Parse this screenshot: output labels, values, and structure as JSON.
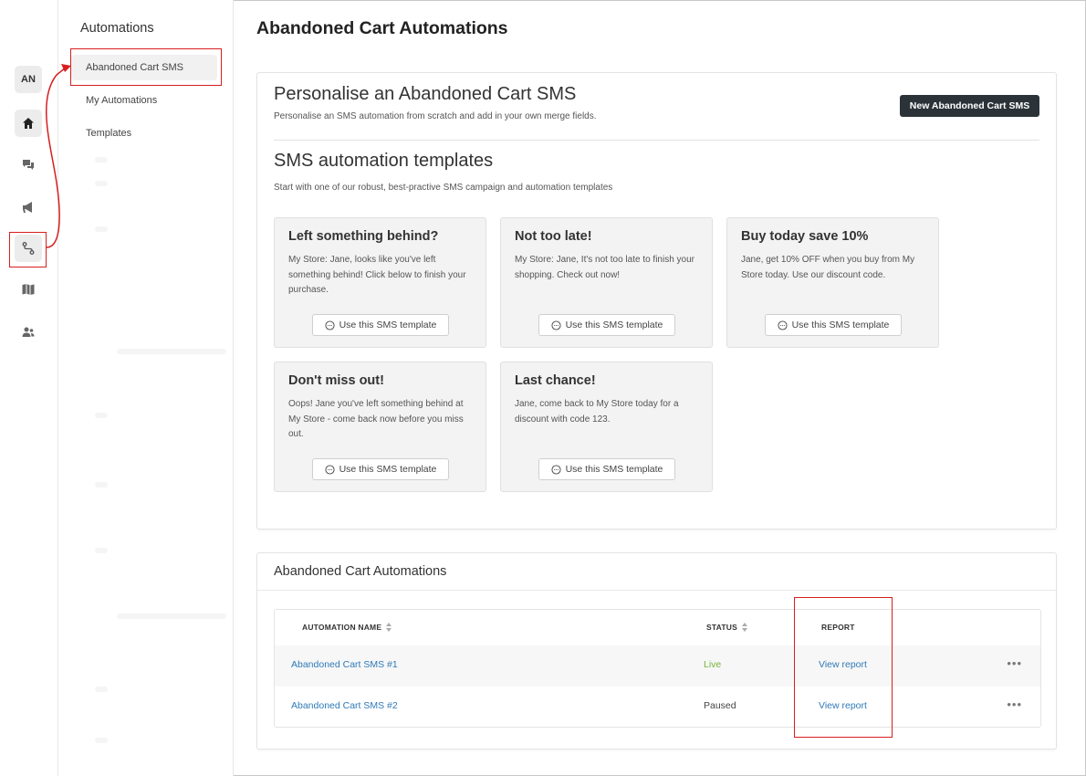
{
  "rail": {
    "avatar": "AN",
    "icons": [
      "home-icon",
      "chat-icon",
      "megaphone-icon",
      "automation-icon",
      "book-icon",
      "users-icon"
    ]
  },
  "subnav": {
    "title": "Automations",
    "items": [
      {
        "label": "Abandoned Cart SMS"
      },
      {
        "label": "My Automations"
      },
      {
        "label": "Templates"
      }
    ]
  },
  "page": {
    "title": "Abandoned Cart Automations"
  },
  "personalise": {
    "heading": "Personalise an Abandoned Cart SMS",
    "subtext": "Personalise an SMS automation from scratch and add in your own merge fields.",
    "button": "New Abandoned Cart SMS"
  },
  "templates": {
    "heading": "SMS automation templates",
    "subtext": "Start with one of our robust, best-practive SMS campaign and automation templates",
    "button_label": "Use this SMS template",
    "items": [
      {
        "title": "Left something behind?",
        "body": "My Store: Jane, looks like you've left something behind! Click below to finish your purchase."
      },
      {
        "title": "Not too late!",
        "body": "My Store: Jane, It's not too late to finish your shopping. Check out now!"
      },
      {
        "title": "Buy today save 10%",
        "body": "Jane, get 10% OFF when you buy from My Store today. Use our discount code."
      },
      {
        "title": "Don't miss out!",
        "body": "Oops! Jane you've left something behind at My Store - come back now before you miss out."
      },
      {
        "title": "Last chance!",
        "body": "Jane, come back to My Store today for a discount with code 123."
      }
    ]
  },
  "automations": {
    "heading": "Abandoned Cart Automations",
    "columns": {
      "name": "AUTOMATION NAME",
      "status": "STATUS",
      "report": "REPORT"
    },
    "rows": [
      {
        "name": "Abandoned Cart SMS #1",
        "status": "Live",
        "report": "View report",
        "more": "•••"
      },
      {
        "name": "Abandoned Cart SMS #2",
        "status": "Paused",
        "report": "View report",
        "more": "•••"
      }
    ]
  },
  "colors": {
    "accent_dark": "#2c3338",
    "link": "#2f7ab8",
    "live": "#74b43a",
    "highlight": "#d81e1e"
  }
}
